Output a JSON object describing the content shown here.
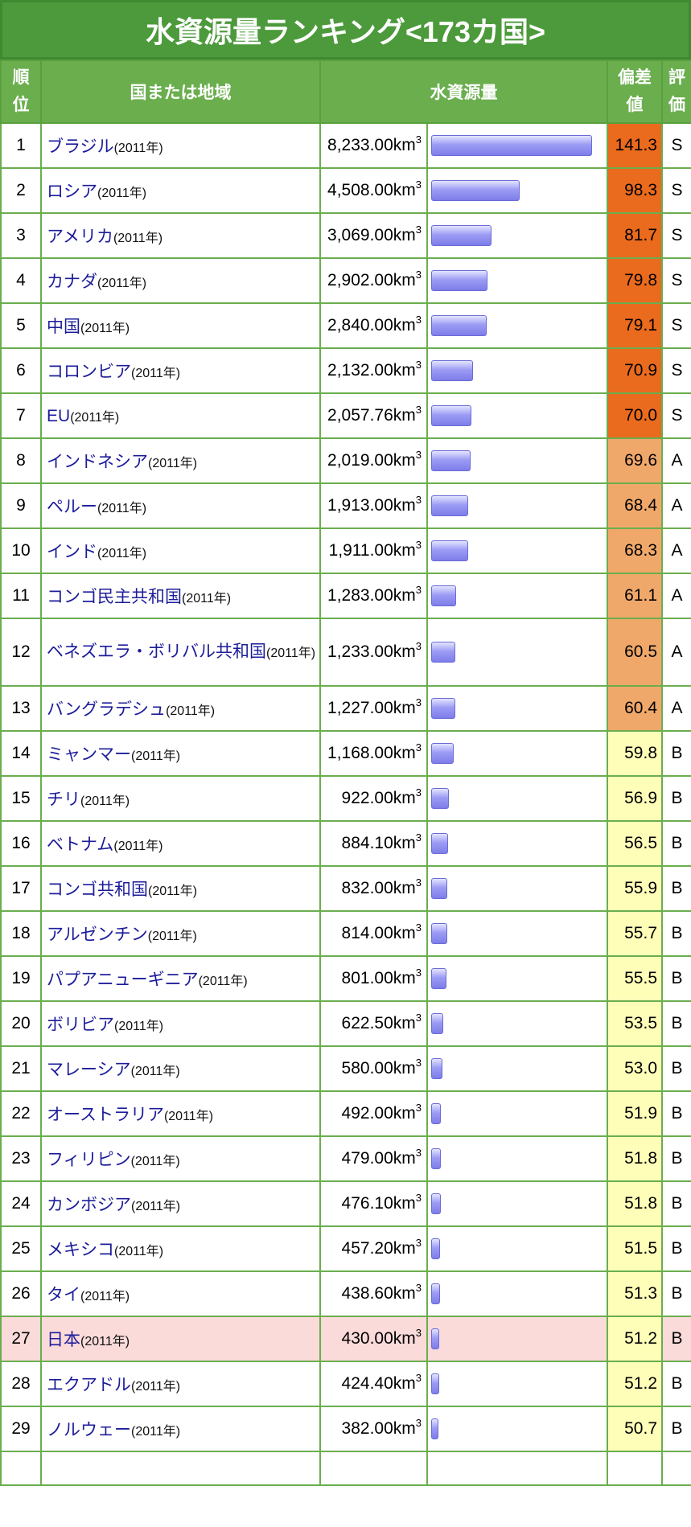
{
  "title": "水資源量ランキング<173カ国>",
  "headers": {
    "rank": "順位",
    "country": "国または地域",
    "amount": "水資源量",
    "deviation": "偏差値",
    "grade": "評価"
  },
  "max_value": 8233.0,
  "highlight_rank": 27,
  "rows": [
    {
      "rank": "1",
      "name": "ブラジル",
      "year": "(2011年)",
      "amount": "8,233.00",
      "unit": "km",
      "exp": "3",
      "value": 8233.0,
      "dev": "141.3",
      "grade": "S"
    },
    {
      "rank": "2",
      "name": "ロシア",
      "year": "(2011年)",
      "amount": "4,508.00",
      "unit": "km",
      "exp": "3",
      "value": 4508.0,
      "dev": "98.3",
      "grade": "S"
    },
    {
      "rank": "3",
      "name": "アメリカ",
      "year": "(2011年)",
      "amount": "3,069.00",
      "unit": "km",
      "exp": "3",
      "value": 3069.0,
      "dev": "81.7",
      "grade": "S"
    },
    {
      "rank": "4",
      "name": "カナダ",
      "year": "(2011年)",
      "amount": "2,902.00",
      "unit": "km",
      "exp": "3",
      "value": 2902.0,
      "dev": "79.8",
      "grade": "S"
    },
    {
      "rank": "5",
      "name": "中国",
      "year": "(2011年)",
      "amount": "2,840.00",
      "unit": "km",
      "exp": "3",
      "value": 2840.0,
      "dev": "79.1",
      "grade": "S"
    },
    {
      "rank": "6",
      "name": "コロンビア",
      "year": "(2011年)",
      "amount": "2,132.00",
      "unit": "km",
      "exp": "3",
      "value": 2132.0,
      "dev": "70.9",
      "grade": "S"
    },
    {
      "rank": "7",
      "name": "EU",
      "year": "(2011年)",
      "amount": "2,057.76",
      "unit": "km",
      "exp": "3",
      "value": 2057.76,
      "dev": "70.0",
      "grade": "S"
    },
    {
      "rank": "8",
      "name": "インドネシア",
      "year": "(2011年)",
      "amount": "2,019.00",
      "unit": "km",
      "exp": "3",
      "value": 2019.0,
      "dev": "69.6",
      "grade": "A"
    },
    {
      "rank": "9",
      "name": "ペルー",
      "year": "(2011年)",
      "amount": "1,913.00",
      "unit": "km",
      "exp": "3",
      "value": 1913.0,
      "dev": "68.4",
      "grade": "A"
    },
    {
      "rank": "10",
      "name": "インド",
      "year": "(2011年)",
      "amount": "1,911.00",
      "unit": "km",
      "exp": "3",
      "value": 1911.0,
      "dev": "68.3",
      "grade": "A"
    },
    {
      "rank": "11",
      "name": "コンゴ民主共和国",
      "year": "(2011年)",
      "amount": "1,283.00",
      "unit": "km",
      "exp": "3",
      "value": 1283.0,
      "dev": "61.1",
      "grade": "A"
    },
    {
      "rank": "12",
      "name": "ベネズエラ・ボリバル共和国",
      "year": "(2011年)",
      "amount": "1,233.00",
      "unit": "km",
      "exp": "3",
      "value": 1233.0,
      "dev": "60.5",
      "grade": "A",
      "tall": true
    },
    {
      "rank": "13",
      "name": "バングラデシュ",
      "year": "(2011年)",
      "amount": "1,227.00",
      "unit": "km",
      "exp": "3",
      "value": 1227.0,
      "dev": "60.4",
      "grade": "A"
    },
    {
      "rank": "14",
      "name": "ミャンマー",
      "year": "(2011年)",
      "amount": "1,168.00",
      "unit": "km",
      "exp": "3",
      "value": 1168.0,
      "dev": "59.8",
      "grade": "B"
    },
    {
      "rank": "15",
      "name": "チリ",
      "year": "(2011年)",
      "amount": "922.00",
      "unit": "km",
      "exp": "3",
      "value": 922.0,
      "dev": "56.9",
      "grade": "B"
    },
    {
      "rank": "16",
      "name": "ベトナム",
      "year": "(2011年)",
      "amount": "884.10",
      "unit": "km",
      "exp": "3",
      "value": 884.1,
      "dev": "56.5",
      "grade": "B"
    },
    {
      "rank": "17",
      "name": "コンゴ共和国",
      "year": "(2011年)",
      "amount": "832.00",
      "unit": "km",
      "exp": "3",
      "value": 832.0,
      "dev": "55.9",
      "grade": "B"
    },
    {
      "rank": "18",
      "name": "アルゼンチン",
      "year": "(2011年)",
      "amount": "814.00",
      "unit": "km",
      "exp": "3",
      "value": 814.0,
      "dev": "55.7",
      "grade": "B"
    },
    {
      "rank": "19",
      "name": "パプアニューギニア",
      "year": "(2011年)",
      "amount": "801.00",
      "unit": "km",
      "exp": "3",
      "value": 801.0,
      "dev": "55.5",
      "grade": "B"
    },
    {
      "rank": "20",
      "name": "ボリビア",
      "year": "(2011年)",
      "amount": "622.50",
      "unit": "km",
      "exp": "3",
      "value": 622.5,
      "dev": "53.5",
      "grade": "B"
    },
    {
      "rank": "21",
      "name": "マレーシア",
      "year": "(2011年)",
      "amount": "580.00",
      "unit": "km",
      "exp": "3",
      "value": 580.0,
      "dev": "53.0",
      "grade": "B"
    },
    {
      "rank": "22",
      "name": "オーストラリア",
      "year": "(2011年)",
      "amount": "492.00",
      "unit": "km",
      "exp": "3",
      "value": 492.0,
      "dev": "51.9",
      "grade": "B"
    },
    {
      "rank": "23",
      "name": "フィリピン",
      "year": "(2011年)",
      "amount": "479.00",
      "unit": "km",
      "exp": "3",
      "value": 479.0,
      "dev": "51.8",
      "grade": "B"
    },
    {
      "rank": "24",
      "name": "カンボジア",
      "year": "(2011年)",
      "amount": "476.10",
      "unit": "km",
      "exp": "3",
      "value": 476.1,
      "dev": "51.8",
      "grade": "B"
    },
    {
      "rank": "25",
      "name": "メキシコ",
      "year": "(2011年)",
      "amount": "457.20",
      "unit": "km",
      "exp": "3",
      "value": 457.2,
      "dev": "51.5",
      "grade": "B"
    },
    {
      "rank": "26",
      "name": "タイ",
      "year": "(2011年)",
      "amount": "438.60",
      "unit": "km",
      "exp": "3",
      "value": 438.6,
      "dev": "51.3",
      "grade": "B"
    },
    {
      "rank": "27",
      "name": "日本",
      "year": "(2011年)",
      "amount": "430.00",
      "unit": "km",
      "exp": "3",
      "value": 430.0,
      "dev": "51.2",
      "grade": "B"
    },
    {
      "rank": "28",
      "name": "エクアドル",
      "year": "(2011年)",
      "amount": "424.40",
      "unit": "km",
      "exp": "3",
      "value": 424.4,
      "dev": "51.2",
      "grade": "B"
    },
    {
      "rank": "29",
      "name": "ノルウェー",
      "year": "(2011年)",
      "amount": "382.00",
      "unit": "km",
      "exp": "3",
      "value": 382.0,
      "dev": "50.7",
      "grade": "B"
    }
  ]
}
